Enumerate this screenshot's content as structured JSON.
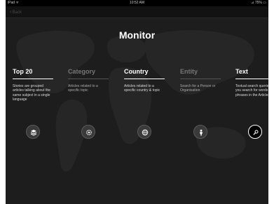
{
  "status": {
    "carrier": "iPad ᯤ",
    "time": "10:52 AM",
    "battery": "⊿ 75% ▭"
  },
  "nav": {
    "back_label": "Back"
  },
  "page": {
    "title": "Monitor"
  },
  "categories": [
    {
      "label": "Top 20",
      "description": "Stories are grouped articles talking about the same subject in a single language",
      "icon": "stack-icon"
    },
    {
      "label": "Category",
      "description": "Articles related to a specific topic",
      "icon": "cog-icon"
    },
    {
      "label": "Country",
      "description": "Articles related to a specific country & topic",
      "icon": "globe-icon"
    },
    {
      "label": "Entity",
      "description": "Search for a Person or Organisation",
      "icon": "person-icon"
    },
    {
      "label": "Text",
      "description": "Textual search queries let you search for words or phrases in the Articles",
      "icon": "magnifier-icon"
    }
  ],
  "colors": {
    "background": "#1d1d1d",
    "accent": "#ffffff",
    "dim_label": "#777777",
    "bar": "#000000"
  }
}
